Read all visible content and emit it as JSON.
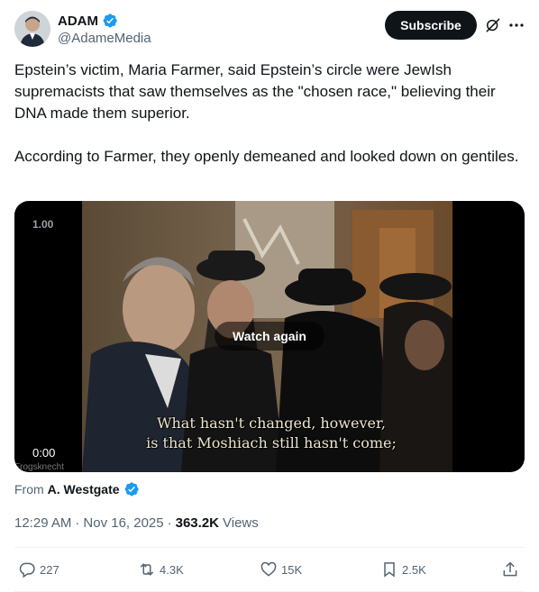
{
  "author": {
    "display_name": "ADAM",
    "handle": "@AdameMedia",
    "verified_icon": "verified-badge-icon"
  },
  "header": {
    "subscribe_label": "Subscribe",
    "grok_icon": "grok-icon",
    "more_icon": "more-icon"
  },
  "tweet": {
    "paragraphs": [
      "Epstein’s victim, Maria Farmer, said Epstein’s circle were JewIsh supremacists that saw themselves as the \"chosen race,\" believing their DNA made them superior.",
      "According to Farmer, they openly demeaned and looked down on gentiles."
    ]
  },
  "video": {
    "speed_label": "1.00",
    "timecode": "0:00",
    "watch_again_label": "Watch again",
    "subtitle_line1": "What hasn't changed, however,",
    "subtitle_line2": "is that Moshiach still hasn't come;",
    "watermark": "Frogsknecht"
  },
  "source": {
    "prefix": "From",
    "name": "A. Westgate"
  },
  "meta": {
    "time": "12:29 AM",
    "separator": "·",
    "date": "Nov 16, 2025",
    "views_count": "363.2K",
    "views_label": "Views"
  },
  "actions": {
    "replies": "227",
    "reposts": "4.3K",
    "likes": "15K",
    "bookmarks": "2.5K"
  },
  "colors": {
    "verified": "#1d9bf0",
    "text_primary": "#0f1419",
    "text_secondary": "#536471",
    "button_dark": "#0f1419"
  }
}
